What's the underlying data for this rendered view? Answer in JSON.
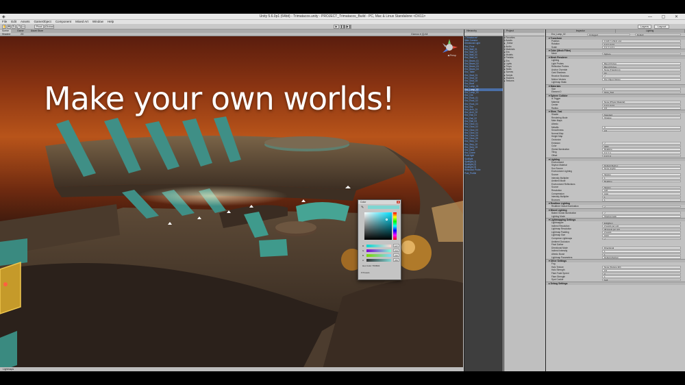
{
  "window": {
    "title": "Unity 5.6.0p1 (64bit) - Trimatacos.unity - PROJECT_Trimatacos_Build - PC, Mac & Linux Standalone <DX11>",
    "controls": "— ▢ ✕"
  },
  "menu": [
    "File",
    "Edit",
    "Assets",
    "GameObject",
    "Component",
    "Mixed Art",
    "Window",
    "Help"
  ],
  "toolbar": {
    "pivot": "Pivot",
    "global": "Global",
    "play": "▶",
    "pause": "❚❚",
    "step": "▶❚",
    "layers": "Layers",
    "layout": "Layout"
  },
  "scene": {
    "tabs": [
      "Scene",
      "Game",
      "Asset Store"
    ],
    "sub_left": "Shaded",
    "sub_mode": "2D",
    "sub_right": "Gizmos  ▾  (Q:All",
    "headline": "Make your own worlds!",
    "gizmo_label": "◀ Persp",
    "status": "Lightmaps"
  },
  "color_picker": {
    "title": "Color",
    "close": "x",
    "swatch_color": "#7fd6d2",
    "rows": [
      {
        "label": "R",
        "value": "127"
      },
      {
        "label": "G",
        "value": "214"
      },
      {
        "label": "B",
        "value": "210"
      },
      {
        "label": "A",
        "value": "255"
      }
    ],
    "hex": "Hex Color   7FD6D2",
    "presets": "▾ Presets"
  },
  "hierarchy": {
    "tab": "Hierarchy",
    "items": [
      "▾ Trimatacos*",
      "  Main Camera",
      "  Directional Light",
      "  Env_Floor",
      "  Env_Wall_01",
      "  Env_Wall_02",
      "  Env_Wall_03",
      "  Env_Wall_04",
      "  Env_Beam_01",
      "  Env_Beam_02",
      "  Env_Beam_03",
      "  Env_Beam_04",
      "  Env_Table",
      "  Env_Seat_01",
      "  Env_Seat_02",
      "  Env_Seat_03",
      "  Env_Bowl",
      "  Env_Lamp_01",
      "  Env_Lamp_02",
      "  Env_Lamp_03",
      "  Env_Orb",
      "  Env_Rock_01",
      "  Env_Rock_02",
      "  Env_Rock_03",
      "  Env_Sky",
      "  Env_Arch_01",
      "  Env_Arch_02",
      "  Env_Rail_01",
      "  Env_Rail_02",
      "  Env_Rail_03",
      "  Env_Glow_01",
      "  Env_Glow_02",
      "  Env_Glow_03",
      "  Env_Glow_04",
      "  Env_Glow_05",
      "  Env_Glow_06",
      "  Env_Step_01",
      "  Env_Step_02",
      "  Env_Step_03",
      "  Env_Deck",
      "  Env_Dome",
      "  Point light",
      "  Spotlight",
      "  Spotlight (1)",
      "  Spotlight (2)",
      "  Spotlight (3)",
      "  Reflection Probe",
      "  Post_Profile"
    ],
    "selected_index": 18
  },
  "project": {
    "tab": "Project",
    "items": [
      "▾ Favorites",
      "▾ Assets",
      "  ▸ _Editor",
      "  ▸ Audio",
      "  ▾ Materials",
      "    ▸ Env",
      "  ▸ Models",
      "  ▾ Prefabs",
      "    ▸ Env",
      "    ▸ Lights",
      "    ▸ Props",
      "    ▸ Seats",
      "  ▸ Scenes",
      "  ▸ Scripts",
      "  ▸ Shaders",
      "  ▸ Textures"
    ]
  },
  "inspector": {
    "tab": "Inspector",
    "tabs": [
      "Inspector",
      "Lighting"
    ],
    "object_name": "Env_Lamp_02",
    "tag": "Untagged",
    "layer": "Default",
    "sections": [
      {
        "header": "▾ Transform",
        "rows": [
          {
            "k": "Position",
            "v": "X 0.8   Y 1.53   Z -3.2"
          },
          {
            "k": "Rotation",
            "v": "X 0   Y 0   Z 0"
          },
          {
            "k": "Scale",
            "v": "X 1   Y 1   Z 1"
          }
        ]
      },
      {
        "header": "▾ Cube (Mesh Filter)",
        "rows": [
          {
            "k": "Mesh",
            "v": "Sphere"
          }
        ]
      },
      {
        "header": "▾ Mesh Renderer",
        "rows": [
          {
            "k": "Lighting",
            "v": ""
          },
          {
            "k": "Light Probes",
            "v": "Blend Probes"
          },
          {
            "k": "Reflection Probes",
            "v": "Blend Probes"
          },
          {
            "k": "Anchor Override",
            "v": "None (Transform)"
          },
          {
            "k": "Cast Shadows",
            "v": "On"
          },
          {
            "k": "Receive Shadows",
            "v": "✓"
          },
          {
            "k": "Motion Vectors",
            "v": "Per Object Motion"
          },
          {
            "k": "Lightmap Static",
            "v": ""
          }
        ]
      },
      {
        "header": "▾ Materials",
        "rows": [
          {
            "k": "Size",
            "v": "1"
          },
          {
            "k": "Element 0",
            "v": "Glow_Teal"
          }
        ]
      },
      {
        "header": "▾ Sphere Collider",
        "rows": [
          {
            "k": "Is Trigger",
            "v": ""
          },
          {
            "k": "Material",
            "v": "None (Physic Material)"
          },
          {
            "k": "Center",
            "v": "X 0   Y 0   Z 0"
          },
          {
            "k": "Radius",
            "v": "0.5"
          }
        ]
      },
      {
        "header": "▾ Glow_Teal",
        "rows": [
          {
            "k": "Shader",
            "v": "Standard"
          },
          {
            "k": "Rendering Mode",
            "v": "Opaque"
          },
          {
            "k": "Main Maps",
            "v": ""
          },
          {
            "k": "Albedo",
            "v": ""
          },
          {
            "k": "Metallic",
            "v": "0"
          },
          {
            "k": "Smoothness",
            "v": "0.5"
          },
          {
            "k": "Normal Map",
            "v": ""
          },
          {
            "k": "Height Map",
            "v": ""
          },
          {
            "k": "Occlusion",
            "v": ""
          },
          {
            "k": "Emission",
            "v": "✓"
          },
          {
            "k": "Color",
            "v": "HDR"
          },
          {
            "k": "Global Illumination",
            "v": "Realtime"
          },
          {
            "k": "Tiling",
            "v": "X 1   Y 1"
          },
          {
            "k": "Offset",
            "v": "X 0   Y 0"
          }
        ]
      },
      {
        "header": "▾ Lighting",
        "rows": [
          {
            "k": "Environment",
            "v": ""
          },
          {
            "k": "Skybox Material",
            "v": "Default-Skybox"
          },
          {
            "k": "Sun Source",
            "v": "None (Light)"
          },
          {
            "k": "Environment Lighting",
            "v": ""
          },
          {
            "k": "Source",
            "v": "Skybox"
          },
          {
            "k": "Intensity Multiplier",
            "v": "1"
          },
          {
            "k": "Ambient Mode",
            "v": "Realtime"
          },
          {
            "k": "Environment Reflections",
            "v": ""
          },
          {
            "k": "Source",
            "v": "Skybox"
          },
          {
            "k": "Resolution",
            "v": "128"
          },
          {
            "k": "Compression",
            "v": "Auto"
          },
          {
            "k": "Intensity Multiplier",
            "v": "1"
          },
          {
            "k": "Bounces",
            "v": "1"
          }
        ]
      },
      {
        "header": "▾ Realtime Lighting",
        "rows": [
          {
            "k": "Realtime Global Illumination",
            "v": "✓"
          }
        ]
      },
      {
        "header": "▾ Mixed Lighting",
        "rows": [
          {
            "k": "Baked Global Illumination",
            "v": "✓"
          },
          {
            "k": "Lighting Mode",
            "v": "Shadowmask"
          }
        ]
      },
      {
        "header": "▾ Lightmapping Settings",
        "rows": [
          {
            "k": "Lightmapper",
            "v": "Enlighten"
          },
          {
            "k": "Indirect Resolution",
            "v": "2   texels per unit"
          },
          {
            "k": "Lightmap Resolution",
            "v": "40   texels per unit"
          },
          {
            "k": "Lightmap Padding",
            "v": "2   texels"
          },
          {
            "k": "Lightmap Size",
            "v": "1024"
          },
          {
            "k": "Compress Lightmaps",
            "v": "✓"
          },
          {
            "k": "Ambient Occlusion",
            "v": ""
          },
          {
            "k": "Final Gather",
            "v": ""
          },
          {
            "k": "Directional Mode",
            "v": "Directional"
          },
          {
            "k": "Indirect Intensity",
            "v": "1"
          },
          {
            "k": "Albedo Boost",
            "v": "1"
          },
          {
            "k": "Lightmap Parameters",
            "v": "Default-Medium"
          }
        ]
      },
      {
        "header": "▾ Other Settings",
        "rows": [
          {
            "k": "Fog",
            "v": ""
          },
          {
            "k": "Halo Texture",
            "v": "None (Texture 2D)"
          },
          {
            "k": "Halo Strength",
            "v": "0.5"
          },
          {
            "k": "Flare Fade Speed",
            "v": "3"
          },
          {
            "k": "Flare Strength",
            "v": "1"
          },
          {
            "k": "Spot Cookie",
            "v": "Soft"
          }
        ]
      },
      {
        "header": "▸ Debug Settings",
        "rows": []
      }
    ]
  }
}
